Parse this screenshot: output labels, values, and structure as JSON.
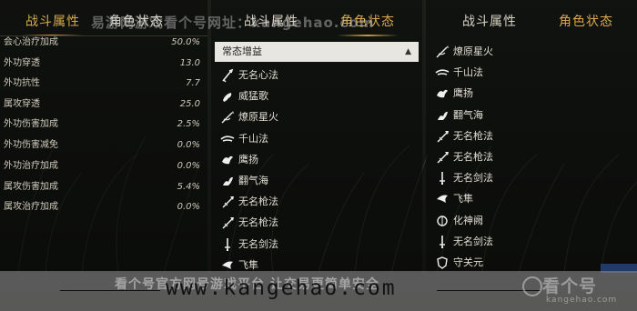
{
  "watermark": {
    "top_text": "易游网游戏看个号网址：kangehao.com",
    "footer_faint": "看个号官方网号游戏平台 让交易更简单安全",
    "url": "www.kangehao.com",
    "logo": "看个号",
    "logo_sub": "kangehao.com"
  },
  "left_panel": {
    "tabs": [
      "战斗属性",
      "角色状态"
    ],
    "active_tab": 0,
    "stats": [
      {
        "label": "会心治疗加成",
        "value": "50.0%"
      },
      {
        "label": "外功穿透",
        "value": "13.0"
      },
      {
        "label": "外功抗性",
        "value": "7.7"
      },
      {
        "label": "属攻穿透",
        "value": "25.0"
      },
      {
        "label": "外功伤害加成",
        "value": "2.5%"
      },
      {
        "label": "外功伤害减免",
        "value": "0.0%"
      },
      {
        "label": "外功治疗加成",
        "value": "0.0%"
      },
      {
        "label": "属攻伤害加成",
        "value": "5.4%"
      },
      {
        "label": "属攻治疗加成",
        "value": "0.0%"
      }
    ]
  },
  "middle_panel": {
    "tabs": [
      "战斗属性",
      "角色状态"
    ],
    "active_tab": 1,
    "dropdown": {
      "selected": "常态增益",
      "caret": "▲"
    },
    "skills": [
      {
        "name": "无名心法",
        "icon": "sword-stance-icon"
      },
      {
        "name": "威猛歌",
        "icon": "fist-icon"
      },
      {
        "name": "燎原星火",
        "icon": "spear-thrust-icon"
      },
      {
        "name": "千山法",
        "icon": "wind-slash-icon"
      },
      {
        "name": "鹰扬",
        "icon": "eagle-icon"
      },
      {
        "name": "翻气海",
        "icon": "wave-icon"
      },
      {
        "name": "无名枪法",
        "icon": "spear-icon"
      },
      {
        "name": "无名枪法",
        "icon": "spear-icon"
      },
      {
        "name": "无名剑法",
        "icon": "sword-icon"
      },
      {
        "name": "飞隼",
        "icon": "falcon-icon"
      }
    ]
  },
  "right_panel": {
    "tabs": [
      "战斗属性",
      "角色状态"
    ],
    "active_tab": 1,
    "skills": [
      {
        "name": "燎原星火",
        "icon": "spear-thrust-icon"
      },
      {
        "name": "千山法",
        "icon": "wind-slash-icon"
      },
      {
        "name": "鹰扬",
        "icon": "eagle-icon"
      },
      {
        "name": "翻气海",
        "icon": "wave-icon"
      },
      {
        "name": "无名枪法",
        "icon": "spear-icon"
      },
      {
        "name": "无名枪法",
        "icon": "spear-icon"
      },
      {
        "name": "无名剑法",
        "icon": "sword-icon"
      },
      {
        "name": "飞隼",
        "icon": "falcon-icon"
      },
      {
        "name": "化神阙",
        "icon": "spirit-icon"
      },
      {
        "name": "无名剑法",
        "icon": "sword-icon"
      },
      {
        "name": "守关元",
        "icon": "guard-icon"
      }
    ]
  },
  "colors": {
    "accent_gold": "#d6a94d",
    "text": "#d9d4c6",
    "dropdown_bg": "#e8e6e1"
  }
}
